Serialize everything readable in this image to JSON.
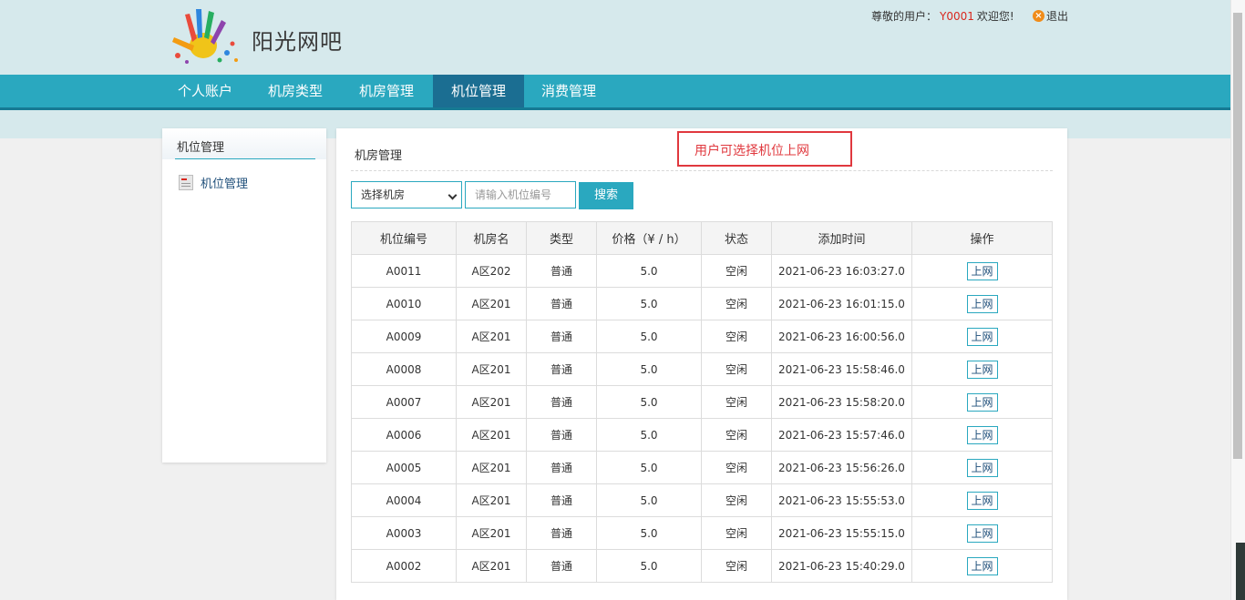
{
  "header": {
    "site_name": "阳光网吧",
    "greeting_prefix": "尊敬的用户：",
    "user_id": "Y0001",
    "greeting_suffix": "欢迎您!",
    "logout_label": "退出"
  },
  "nav": {
    "items": [
      {
        "label": "个人账户"
      },
      {
        "label": "机房类型"
      },
      {
        "label": "机房管理"
      },
      {
        "label": "机位管理"
      },
      {
        "label": "消费管理"
      }
    ],
    "active_index": 3
  },
  "sidebar": {
    "title": "机位管理",
    "items": [
      {
        "label": "机位管理"
      }
    ]
  },
  "main": {
    "title": "机房管理",
    "annotation": "用户可选择机位上网",
    "room_select_value": "选择机房",
    "search_placeholder": "请输入机位编号",
    "search_button": "搜索"
  },
  "table": {
    "columns": [
      "机位编号",
      "机房名",
      "类型",
      "价格（¥ / h）",
      "状态",
      "添加时间",
      "操作"
    ],
    "rows": [
      [
        "A0011",
        "A区202",
        "普通",
        "5.0",
        "空闲",
        "2021-06-23 16:03:27.0",
        "上网"
      ],
      [
        "A0010",
        "A区201",
        "普通",
        "5.0",
        "空闲",
        "2021-06-23 16:01:15.0",
        "上网"
      ],
      [
        "A0009",
        "A区201",
        "普通",
        "5.0",
        "空闲",
        "2021-06-23 16:00:56.0",
        "上网"
      ],
      [
        "A0008",
        "A区201",
        "普通",
        "5.0",
        "空闲",
        "2021-06-23 15:58:46.0",
        "上网"
      ],
      [
        "A0007",
        "A区201",
        "普通",
        "5.0",
        "空闲",
        "2021-06-23 15:58:20.0",
        "上网"
      ],
      [
        "A0006",
        "A区201",
        "普通",
        "5.0",
        "空闲",
        "2021-06-23 15:57:46.0",
        "上网"
      ],
      [
        "A0005",
        "A区201",
        "普通",
        "5.0",
        "空闲",
        "2021-06-23 15:56:26.0",
        "上网"
      ],
      [
        "A0004",
        "A区201",
        "普通",
        "5.0",
        "空闲",
        "2021-06-23 15:55:53.0",
        "上网"
      ],
      [
        "A0003",
        "A区201",
        "普通",
        "5.0",
        "空闲",
        "2021-06-23 15:55:15.0",
        "上网"
      ],
      [
        "A0002",
        "A区201",
        "普通",
        "5.0",
        "空闲",
        "2021-06-23 15:40:29.0",
        "上网"
      ]
    ]
  },
  "colors": {
    "nav_bg": "#2aa8bf",
    "nav_active": "#1b6e92",
    "header_bg": "#d6e9ec",
    "user_id": "#d9281f",
    "annotation": "#e0383e"
  }
}
